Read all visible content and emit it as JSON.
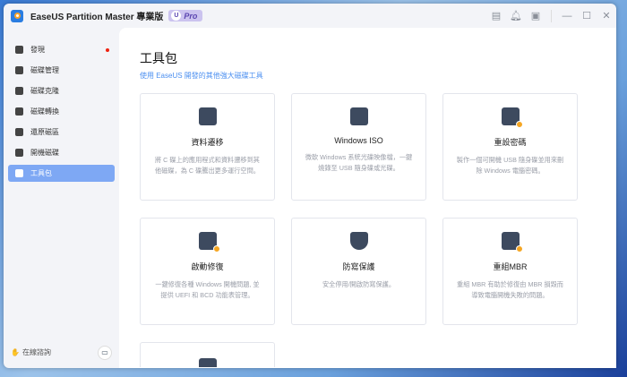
{
  "app": {
    "title": "EaseUS Partition Master 專業版",
    "badge": "Pro",
    "badge_letter": "U"
  },
  "sidebar": {
    "items": [
      {
        "label": "發現",
        "dot": true
      },
      {
        "label": "磁碟管理"
      },
      {
        "label": "磁碟克隆"
      },
      {
        "label": "磁碟轉換"
      },
      {
        "label": "還原磁區"
      },
      {
        "label": "開機磁碟"
      },
      {
        "label": "工具包",
        "active": true
      }
    ],
    "help": "在線諮詢"
  },
  "main": {
    "title": "工具包",
    "subtitle": "使用 EaseUS 開發的其他強大磁碟工具",
    "cards": [
      {
        "title": "資料遷移",
        "desc": "將 C 碟上的應用程式和資料遷移到其他磁碟，為 C 碟騰出更多運行空間。",
        "icon": "disk-chart-icon"
      },
      {
        "title": "Windows ISO",
        "desc": "微軟 Windows 系統光碟映像檔，一鍵燒錄至 USB 隨身碟或光碟。",
        "icon": "iso-icon"
      },
      {
        "title": "重設密碼",
        "desc": "製作一個可開機 USB 隨身碟並用來刪除 Windows 電腦密碼。",
        "icon": "lock-icon"
      },
      {
        "title": "啟動修復",
        "desc": "一鍵修復各種 Windows 開機問題, 並提供 UEFI 和 BCD 功能表管理。",
        "icon": "windows-repair-icon"
      },
      {
        "title": "防寫保護",
        "desc": "安全停用/開啟防寫保護。",
        "icon": "shield-icon"
      },
      {
        "title": "重組MBR",
        "desc": "重組 MBR 有助於修復由 MBR 損毀而導致電腦開機失敗的問題。",
        "icon": "mbr-icon"
      },
      {
        "title": "",
        "desc": "",
        "icon": "tool-icon"
      }
    ]
  }
}
